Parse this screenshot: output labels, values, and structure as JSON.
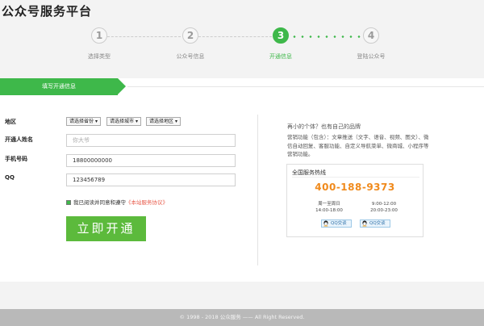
{
  "header": {
    "title": "公众号服务平台"
  },
  "steps": [
    {
      "number": "1",
      "label": "选择类型"
    },
    {
      "number": "2",
      "label": "公众号信息"
    },
    {
      "number": "3",
      "label": "开通信息"
    },
    {
      "number": "4",
      "label": "登陆公众号"
    }
  ],
  "active_step": 3,
  "colors": {
    "accent": "#3eb84a",
    "phone": "#f08a1c",
    "link": "#e85a4a"
  },
  "form": {
    "banner": "填写开通信息",
    "region_label": "地区",
    "province": "请选择省份",
    "city": "请选择城市",
    "district": "请选择地区",
    "name_label": "开通人姓名",
    "name_placeholder": "你大爷",
    "phone_label": "手机号码",
    "phone_value": "18800000000",
    "qq_label": "QQ",
    "qq_value": "123456789",
    "agree_text": "我已阅读并同意和遵守",
    "agree_link": "《本站服务协议》",
    "submit": "立即开通"
  },
  "sidebar": {
    "question": "再小的个体？也有自己的品牌",
    "description": "营销功能（包含）：文章推送（文字、语音、视频、图文）、微信自动回复、客服功能、自定义导航菜单、微商城、小程序等营销功能。",
    "hotline": {
      "title": "全国服务热线",
      "phone": "400-188-9373",
      "times": [
        {
          "days": "周一至周日",
          "hours": "14:00-18:00"
        },
        {
          "days": "9:00-12:00",
          "hours": "20:00-23:00"
        }
      ],
      "qq_buttons": [
        "QQ交谈",
        "QQ交谈"
      ]
    }
  },
  "footer": {
    "copyright": "© 1998 - 2018 公众服务 —— All Right Reserved."
  }
}
